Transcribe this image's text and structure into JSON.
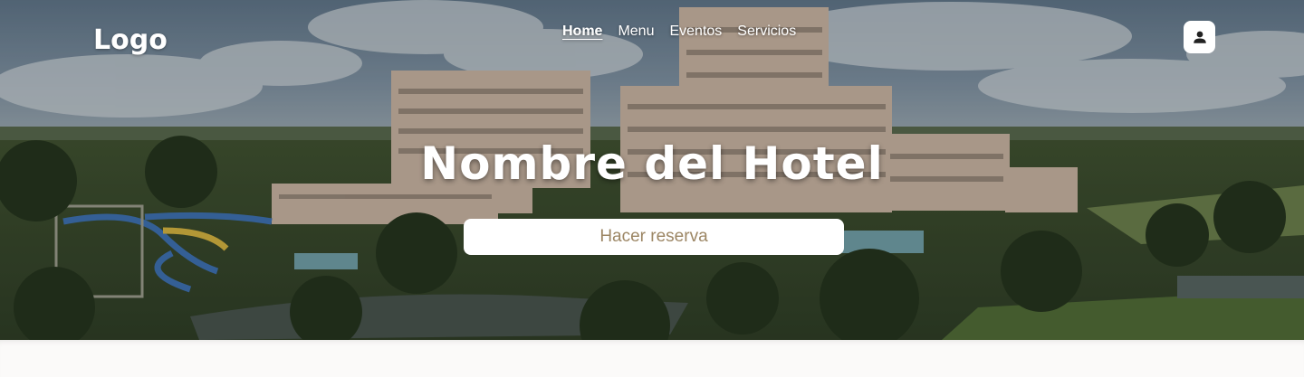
{
  "header": {
    "logo": "Logo",
    "nav": [
      {
        "label": "Home",
        "active": true
      },
      {
        "label": "Menu",
        "active": false
      },
      {
        "label": "Eventos",
        "active": false
      },
      {
        "label": "Servicios",
        "active": false
      }
    ],
    "user_icon": "user-icon"
  },
  "hero": {
    "title": "Nombre del Hotel",
    "reserve_label": "Hacer reserva",
    "background": "hotel-aerial-photo"
  },
  "colors": {
    "button_text": "#9c8664",
    "button_bg": "#ffffff",
    "text_light": "#ffffff",
    "page_bg": "#fbfaf9"
  }
}
